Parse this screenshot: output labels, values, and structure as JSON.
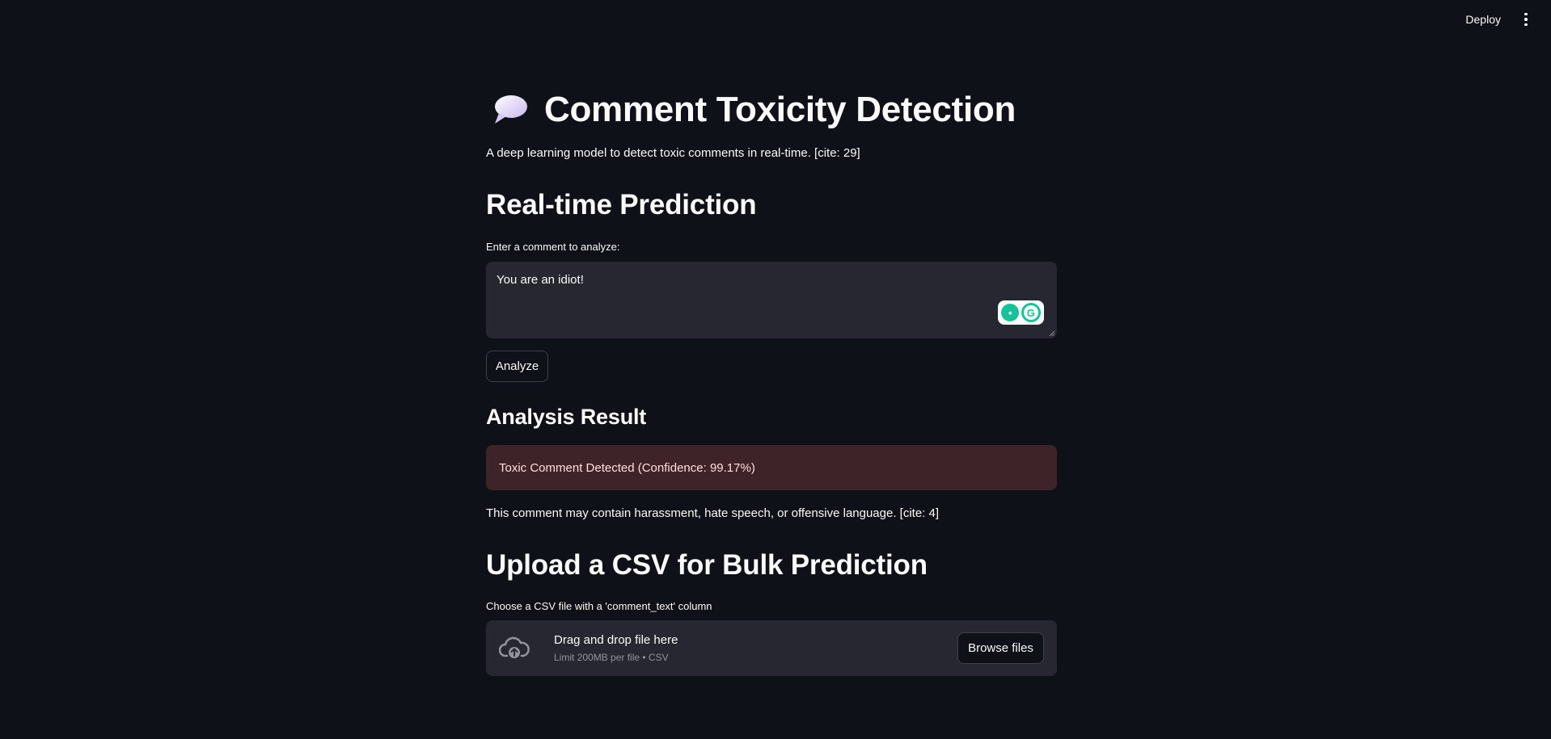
{
  "topbar": {
    "deploy_label": "Deploy"
  },
  "header": {
    "title": "Comment Toxicity Detection",
    "subtitle": "A deep learning model to detect toxic comments in real-time. [cite: 29]"
  },
  "realtime": {
    "heading": "Real-time Prediction",
    "input_label": "Enter a comment to analyze:",
    "input_value": "You are an idiot!",
    "analyze_label": "Analyze"
  },
  "result": {
    "heading": "Analysis Result",
    "alert_text": "Toxic Comment Detected (Confidence: 99.17%)",
    "note": "This comment may contain harassment, hate speech, or offensive language. [cite: 4]"
  },
  "bulk": {
    "heading": "Upload a CSV for Bulk Prediction",
    "file_label": "Choose a CSV file with a 'comment_text' column",
    "drop_text": "Drag and drop file here",
    "limit_text": "Limit 200MB per file • CSV",
    "browse_label": "Browse files"
  },
  "icons": {
    "title_icon": "speech-bubble-icon",
    "upload_icon": "cloud-upload-icon",
    "menu_icon": "kebab-menu-icon"
  },
  "colors": {
    "background": "#0e1117",
    "input_bg": "#262730",
    "error_bg": "#3e2328",
    "error_text": "#ffdede",
    "grammarly": "#15c39a"
  }
}
